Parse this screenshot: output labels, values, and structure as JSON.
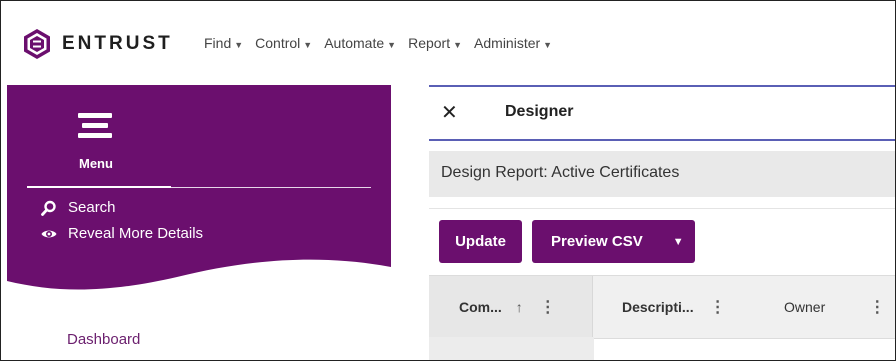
{
  "brand": {
    "name": "ENTRUST",
    "colors": {
      "primary": "#6b0f6e",
      "accent": "#5a5fb5"
    }
  },
  "nav": {
    "items": [
      {
        "label": "Find"
      },
      {
        "label": "Control"
      },
      {
        "label": "Automate"
      },
      {
        "label": "Report"
      },
      {
        "label": "Administer"
      }
    ]
  },
  "menu": {
    "title": "Menu",
    "search_label": "Search",
    "reveal_label": "Reveal More Details",
    "dashboard_label": "Dashboard",
    "icons": [
      "hamburger-icon",
      "search-icon",
      "eye-icon"
    ]
  },
  "designer": {
    "title": "Designer",
    "report_title": "Design Report: Active Certificates",
    "update_label": "Update",
    "preview_label": "Preview CSV",
    "columns": [
      {
        "label": "Com...",
        "sort": "↑"
      },
      {
        "label": "Descripti..."
      },
      {
        "label": "Owner"
      }
    ]
  }
}
